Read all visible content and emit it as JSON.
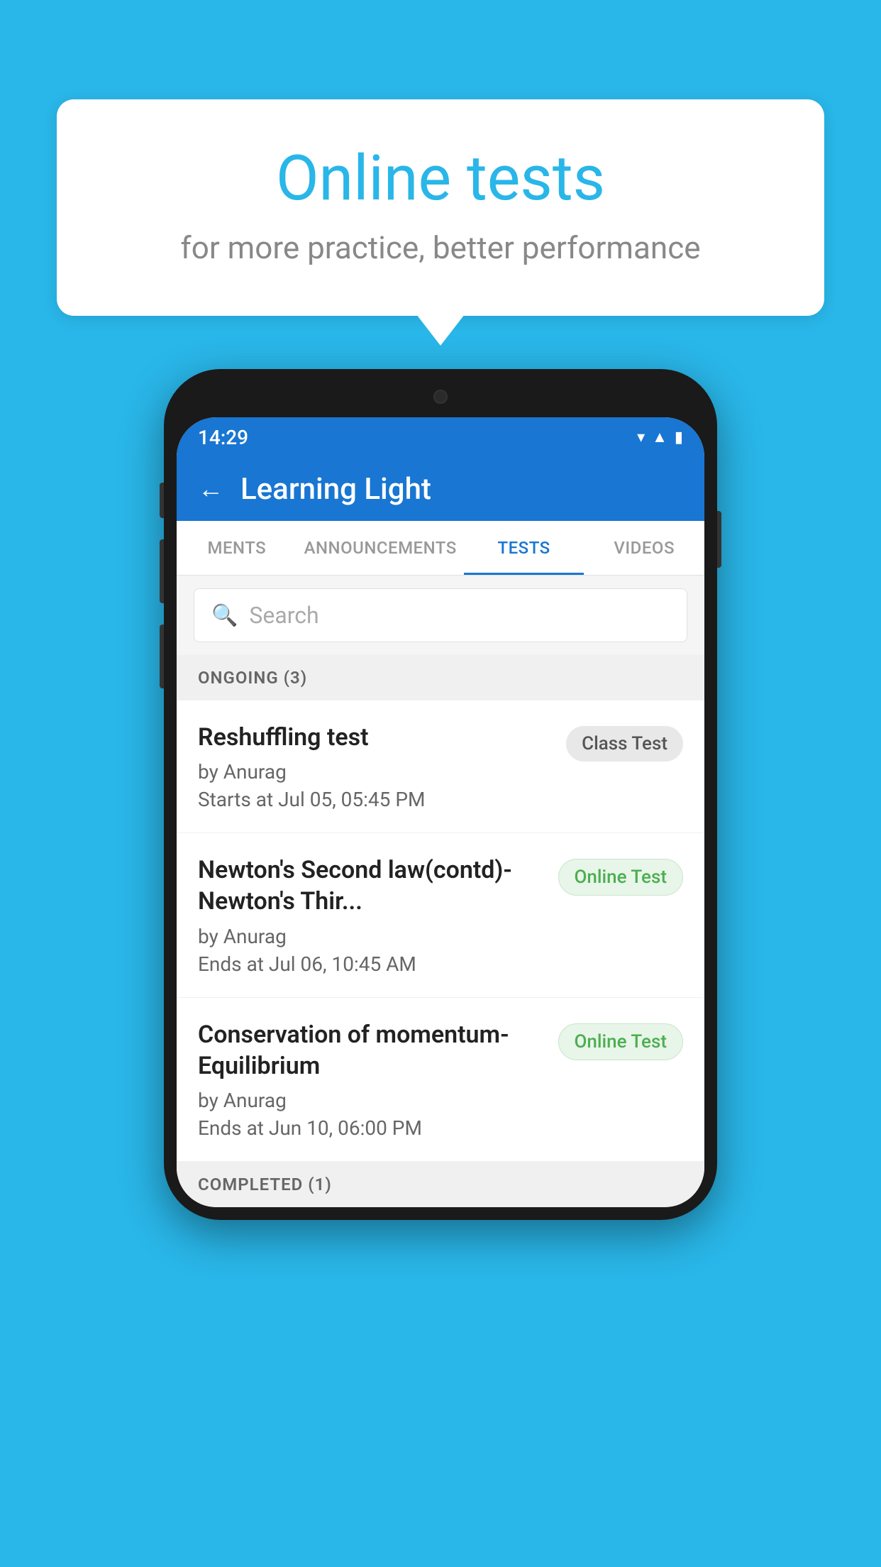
{
  "background_color": "#29b6e8",
  "bubble": {
    "title": "Online tests",
    "subtitle": "for more practice, better performance"
  },
  "phone": {
    "status_bar": {
      "time": "14:29",
      "icons": [
        "wifi",
        "signal",
        "battery"
      ]
    },
    "header": {
      "title": "Learning Light",
      "back_label": "←"
    },
    "tabs": [
      {
        "label": "MENTS",
        "active": false
      },
      {
        "label": "ANNOUNCEMENTS",
        "active": false
      },
      {
        "label": "TESTS",
        "active": true
      },
      {
        "label": "VIDEOS",
        "active": false
      }
    ],
    "search": {
      "placeholder": "Search"
    },
    "ongoing_section": {
      "label": "ONGOING (3)"
    },
    "tests": [
      {
        "name": "Reshuffling test",
        "author": "by Anurag",
        "date": "Starts at  Jul 05, 05:45 PM",
        "badge": "Class Test",
        "badge_type": "class"
      },
      {
        "name": "Newton's Second law(contd)-Newton's Thir...",
        "author": "by Anurag",
        "date": "Ends at  Jul 06, 10:45 AM",
        "badge": "Online Test",
        "badge_type": "online"
      },
      {
        "name": "Conservation of momentum-Equilibrium",
        "author": "by Anurag",
        "date": "Ends at  Jun 10, 06:00 PM",
        "badge": "Online Test",
        "badge_type": "online"
      }
    ],
    "completed_section": {
      "label": "COMPLETED (1)"
    }
  }
}
